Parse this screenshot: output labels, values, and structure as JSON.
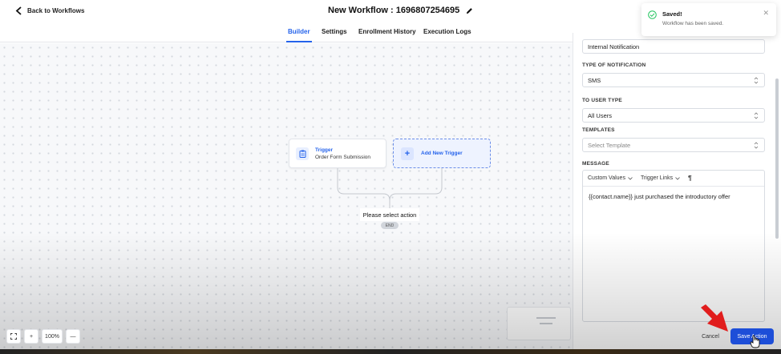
{
  "header": {
    "back_label": "Back to Workflows",
    "title": "New Workflow : 1696807254695"
  },
  "tabs": [
    {
      "label": "Builder",
      "active": true
    },
    {
      "label": "Settings",
      "active": false
    },
    {
      "label": "Enrollment History",
      "active": false
    },
    {
      "label": "Execution Logs",
      "active": false
    }
  ],
  "canvas": {
    "trigger_title": "Trigger",
    "trigger_subtitle": "Order Form Submission",
    "add_trigger": "Add New Trigger",
    "select_action": "Please select action",
    "end_label": "END",
    "zoom": "100%",
    "zoom_in": "+",
    "zoom_out": "—"
  },
  "panel": {
    "action_name_value": "Internal Notification",
    "notification_type_label": "TYPE OF NOTIFICATION",
    "notification_type_value": "SMS",
    "user_type_label": "TO USER TYPE",
    "user_type_value": "All Users",
    "templates_label": "TEMPLATES",
    "templates_placeholder": "Select Template",
    "message_label": "MESSAGE",
    "custom_values": "Custom Values",
    "trigger_links": "Trigger Links",
    "paragraph_symbol": "¶",
    "message_text": "{{contact.name}} just purchased the introductory offer",
    "cancel": "Cancel",
    "save": "Save Action"
  },
  "toast": {
    "title": "Saved!",
    "message": "Workflow has been saved."
  },
  "colors": {
    "accent": "#2563eb",
    "save_button": "#1d4ed8",
    "success": "#22c55e",
    "annotation_arrow": "#e11d1d"
  }
}
